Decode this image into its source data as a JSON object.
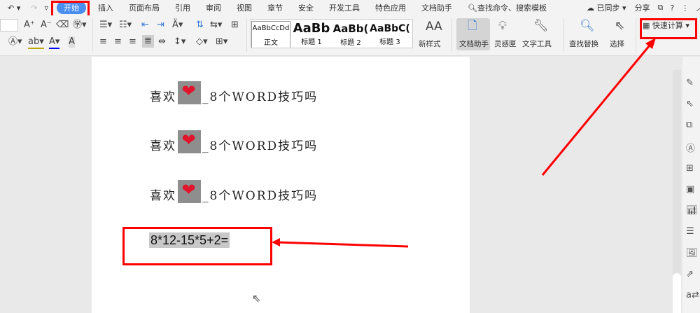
{
  "quick_access": {
    "undo_icon": "undo-icon",
    "redo_icon": "redo-icon",
    "customize_icon": "chevron-down-icon"
  },
  "tabs": [
    "开始",
    "插入",
    "页面布局",
    "引用",
    "审阅",
    "视图",
    "章节",
    "安全",
    "开发工具",
    "特色应用",
    "文档助手"
  ],
  "search": {
    "placeholder": "查找命令、搜索模板"
  },
  "top_right": {
    "sync": "已同步",
    "share": "分享"
  },
  "styles": [
    {
      "preview": "AaBbCcDd",
      "name": "正文"
    },
    {
      "preview": "AaBb",
      "name": "标题 1"
    },
    {
      "preview": "AaBb(",
      "name": "标题 2"
    },
    {
      "preview": "AaBbC(",
      "name": "标题 3"
    }
  ],
  "ribbon": {
    "new_style": "新样式",
    "doc_helper": "文档助手",
    "inspiration": "灵感匣",
    "text_tools": "文字工具",
    "find_replace": "查找替换",
    "select": "选择",
    "quick_calc": "快速计算"
  },
  "document": {
    "lines": [
      {
        "before": "喜欢",
        "after": "_8个WORD技巧吗"
      },
      {
        "before": "喜欢",
        "after": "_8个WORD技巧吗"
      },
      {
        "before": "喜欢",
        "after": "_8个WORD技巧吗"
      }
    ],
    "formula": "8*12-15*5+2="
  },
  "colors": {
    "accent": "#4a8ef0",
    "annotation": "#ff0000"
  }
}
